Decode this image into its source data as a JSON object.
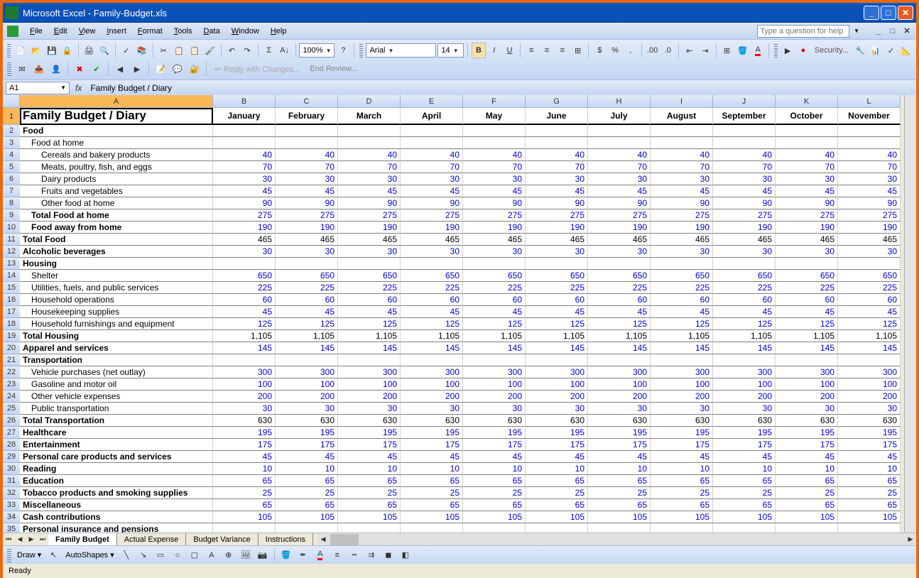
{
  "title_prefix": "Microsoft Excel",
  "title_file": "Family-Budget.xls",
  "menu": [
    "File",
    "Edit",
    "View",
    "Insert",
    "Format",
    "Tools",
    "Data",
    "Window",
    "Help"
  ],
  "help_placeholder": "Type a question for help",
  "toolbar": {
    "zoom": "100%",
    "font": "Arial",
    "font_size": "14",
    "reply_changes": "Reply with Changes...",
    "end_review": "End Review...",
    "security": "Security...",
    "draw": "Draw",
    "autoshapes": "AutoShapes"
  },
  "namebox": "A1",
  "formula": "Family Budget / Diary",
  "columns": [
    "A",
    "B",
    "C",
    "D",
    "E",
    "F",
    "G",
    "H",
    "I",
    "J",
    "K",
    "L"
  ],
  "months": [
    "January",
    "February",
    "March",
    "April",
    "May",
    "June",
    "July",
    "August",
    "September",
    "October",
    "November"
  ],
  "sheet_tabs": [
    "Family Budget",
    "Actual Expense",
    "Budget Variance",
    "Instructions"
  ],
  "status": "Ready",
  "rows": [
    {
      "n": 1,
      "a": "Family Budget / Diary",
      "type": "title",
      "vals": []
    },
    {
      "n": 2,
      "a": "Food",
      "type": "section",
      "vals": []
    },
    {
      "n": 3,
      "a": "Food at home",
      "type": "sub1",
      "vals": []
    },
    {
      "n": 4,
      "a": "Cereals and bakery products",
      "type": "sub2",
      "val": "40"
    },
    {
      "n": 5,
      "a": "Meats, poultry, fish, and eggs",
      "type": "sub2",
      "val": "70"
    },
    {
      "n": 6,
      "a": "Dairy products",
      "type": "sub2",
      "val": "30"
    },
    {
      "n": 7,
      "a": "Fruits and vegetables",
      "type": "sub2",
      "val": "45"
    },
    {
      "n": 8,
      "a": "Other food at home",
      "type": "sub2",
      "val": "90"
    },
    {
      "n": 9,
      "a": "Total Food at home",
      "type": "totalsub",
      "val": "275"
    },
    {
      "n": 10,
      "a": "Food away from home",
      "type": "boldsub",
      "val": "190"
    },
    {
      "n": 11,
      "a": "Total Food",
      "type": "total",
      "val": "465"
    },
    {
      "n": 12,
      "a": "Alcoholic beverages",
      "type": "section",
      "val": "30"
    },
    {
      "n": 13,
      "a": "Housing",
      "type": "section",
      "vals": []
    },
    {
      "n": 14,
      "a": "Shelter",
      "type": "sub1",
      "val": "650"
    },
    {
      "n": 15,
      "a": "Utilities, fuels, and public services",
      "type": "sub1",
      "val": "225"
    },
    {
      "n": 16,
      "a": "Household operations",
      "type": "sub1",
      "val": "60"
    },
    {
      "n": 17,
      "a": "Housekeeping supplies",
      "type": "sub1",
      "val": "45"
    },
    {
      "n": 18,
      "a": "Household furnishings and equipment",
      "type": "sub1",
      "val": "125"
    },
    {
      "n": 19,
      "a": "Total Housing",
      "type": "total",
      "val": "1,105"
    },
    {
      "n": 20,
      "a": "Apparel and services",
      "type": "section",
      "val": "145"
    },
    {
      "n": 21,
      "a": "Transportation",
      "type": "section",
      "vals": []
    },
    {
      "n": 22,
      "a": "Vehicle purchases (net outlay)",
      "type": "sub1",
      "val": "300"
    },
    {
      "n": 23,
      "a": "Gasoline and motor oil",
      "type": "sub1",
      "val": "100"
    },
    {
      "n": 24,
      "a": "Other vehicle expenses",
      "type": "sub1",
      "val": "200"
    },
    {
      "n": 25,
      "a": "Public transportation",
      "type": "sub1",
      "val": "30"
    },
    {
      "n": 26,
      "a": "Total Transportation",
      "type": "total",
      "val": "630"
    },
    {
      "n": 27,
      "a": "Healthcare",
      "type": "section",
      "val": "195"
    },
    {
      "n": 28,
      "a": "Entertainment",
      "type": "section",
      "val": "175"
    },
    {
      "n": 29,
      "a": "Personal care products and services",
      "type": "section",
      "val": "45"
    },
    {
      "n": 30,
      "a": "Reading",
      "type": "section",
      "val": "10"
    },
    {
      "n": 31,
      "a": "Education",
      "type": "section",
      "val": "65"
    },
    {
      "n": 32,
      "a": "Tobacco products and smoking supplies",
      "type": "section",
      "val": "25"
    },
    {
      "n": 33,
      "a": "Miscellaneous",
      "type": "section",
      "val": "65"
    },
    {
      "n": 34,
      "a": "Cash contributions",
      "type": "section",
      "val": "105"
    },
    {
      "n": 35,
      "a": "Personal insurance and pensions",
      "type": "section",
      "vals": []
    }
  ]
}
